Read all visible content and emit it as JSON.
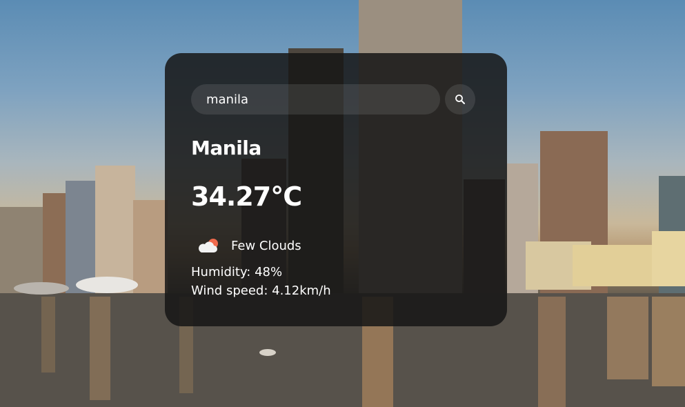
{
  "search": {
    "value": "manila",
    "button_icon": "search-icon"
  },
  "weather": {
    "city": "Manila",
    "temperature": "34.27°C",
    "condition_icon": "few-clouds-icon",
    "condition": "Few Clouds",
    "humidity": "Humidity: 48%",
    "wind_speed": "Wind speed: 4.12km/h"
  },
  "colors": {
    "card_background": "#161616",
    "text": "#ffffff",
    "sun_accent": "#ef6a4d"
  }
}
